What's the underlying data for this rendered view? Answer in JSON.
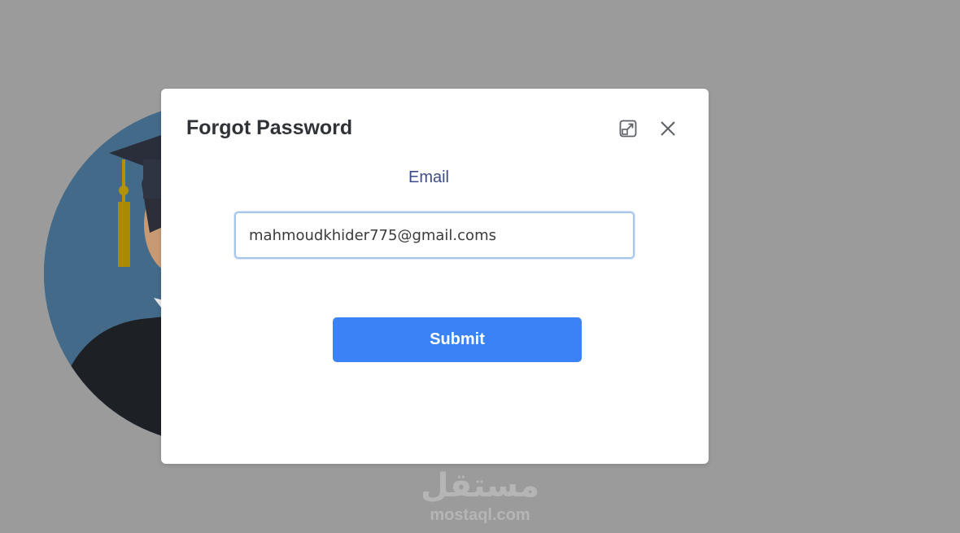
{
  "modal": {
    "title": "Forgot Password",
    "email_label": "Email",
    "email_value": "mahmoudkhider775@gmail.coms",
    "submit_label": "Submit",
    "icons": [
      "expand-icon",
      "close-icon"
    ]
  },
  "watermark": {
    "arabic_text": "مستقل",
    "url_text": "mostaql.com"
  },
  "colors": {
    "backdrop": "#9b9b9b",
    "submit_button": "#3b82f6",
    "label": "#3d4b8a",
    "input_border": "#a6c6ee"
  }
}
